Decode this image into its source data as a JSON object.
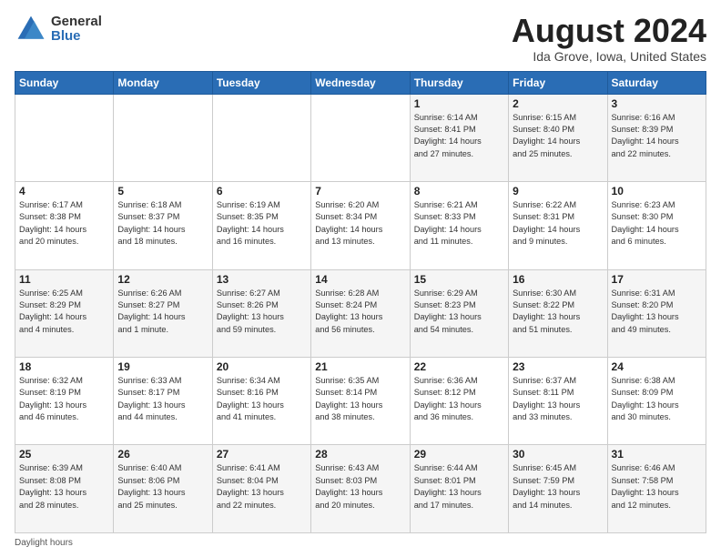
{
  "header": {
    "logo_general": "General",
    "logo_blue": "Blue",
    "title": "August 2024",
    "location": "Ida Grove, Iowa, United States"
  },
  "weekdays": [
    "Sunday",
    "Monday",
    "Tuesday",
    "Wednesday",
    "Thursday",
    "Friday",
    "Saturday"
  ],
  "weeks": [
    [
      {
        "day": "",
        "detail": ""
      },
      {
        "day": "",
        "detail": ""
      },
      {
        "day": "",
        "detail": ""
      },
      {
        "day": "",
        "detail": ""
      },
      {
        "day": "1",
        "detail": "Sunrise: 6:14 AM\nSunset: 8:41 PM\nDaylight: 14 hours\nand 27 minutes."
      },
      {
        "day": "2",
        "detail": "Sunrise: 6:15 AM\nSunset: 8:40 PM\nDaylight: 14 hours\nand 25 minutes."
      },
      {
        "day": "3",
        "detail": "Sunrise: 6:16 AM\nSunset: 8:39 PM\nDaylight: 14 hours\nand 22 minutes."
      }
    ],
    [
      {
        "day": "4",
        "detail": "Sunrise: 6:17 AM\nSunset: 8:38 PM\nDaylight: 14 hours\nand 20 minutes."
      },
      {
        "day": "5",
        "detail": "Sunrise: 6:18 AM\nSunset: 8:37 PM\nDaylight: 14 hours\nand 18 minutes."
      },
      {
        "day": "6",
        "detail": "Sunrise: 6:19 AM\nSunset: 8:35 PM\nDaylight: 14 hours\nand 16 minutes."
      },
      {
        "day": "7",
        "detail": "Sunrise: 6:20 AM\nSunset: 8:34 PM\nDaylight: 14 hours\nand 13 minutes."
      },
      {
        "day": "8",
        "detail": "Sunrise: 6:21 AM\nSunset: 8:33 PM\nDaylight: 14 hours\nand 11 minutes."
      },
      {
        "day": "9",
        "detail": "Sunrise: 6:22 AM\nSunset: 8:31 PM\nDaylight: 14 hours\nand 9 minutes."
      },
      {
        "day": "10",
        "detail": "Sunrise: 6:23 AM\nSunset: 8:30 PM\nDaylight: 14 hours\nand 6 minutes."
      }
    ],
    [
      {
        "day": "11",
        "detail": "Sunrise: 6:25 AM\nSunset: 8:29 PM\nDaylight: 14 hours\nand 4 minutes."
      },
      {
        "day": "12",
        "detail": "Sunrise: 6:26 AM\nSunset: 8:27 PM\nDaylight: 14 hours\nand 1 minute."
      },
      {
        "day": "13",
        "detail": "Sunrise: 6:27 AM\nSunset: 8:26 PM\nDaylight: 13 hours\nand 59 minutes."
      },
      {
        "day": "14",
        "detail": "Sunrise: 6:28 AM\nSunset: 8:24 PM\nDaylight: 13 hours\nand 56 minutes."
      },
      {
        "day": "15",
        "detail": "Sunrise: 6:29 AM\nSunset: 8:23 PM\nDaylight: 13 hours\nand 54 minutes."
      },
      {
        "day": "16",
        "detail": "Sunrise: 6:30 AM\nSunset: 8:22 PM\nDaylight: 13 hours\nand 51 minutes."
      },
      {
        "day": "17",
        "detail": "Sunrise: 6:31 AM\nSunset: 8:20 PM\nDaylight: 13 hours\nand 49 minutes."
      }
    ],
    [
      {
        "day": "18",
        "detail": "Sunrise: 6:32 AM\nSunset: 8:19 PM\nDaylight: 13 hours\nand 46 minutes."
      },
      {
        "day": "19",
        "detail": "Sunrise: 6:33 AM\nSunset: 8:17 PM\nDaylight: 13 hours\nand 44 minutes."
      },
      {
        "day": "20",
        "detail": "Sunrise: 6:34 AM\nSunset: 8:16 PM\nDaylight: 13 hours\nand 41 minutes."
      },
      {
        "day": "21",
        "detail": "Sunrise: 6:35 AM\nSunset: 8:14 PM\nDaylight: 13 hours\nand 38 minutes."
      },
      {
        "day": "22",
        "detail": "Sunrise: 6:36 AM\nSunset: 8:12 PM\nDaylight: 13 hours\nand 36 minutes."
      },
      {
        "day": "23",
        "detail": "Sunrise: 6:37 AM\nSunset: 8:11 PM\nDaylight: 13 hours\nand 33 minutes."
      },
      {
        "day": "24",
        "detail": "Sunrise: 6:38 AM\nSunset: 8:09 PM\nDaylight: 13 hours\nand 30 minutes."
      }
    ],
    [
      {
        "day": "25",
        "detail": "Sunrise: 6:39 AM\nSunset: 8:08 PM\nDaylight: 13 hours\nand 28 minutes."
      },
      {
        "day": "26",
        "detail": "Sunrise: 6:40 AM\nSunset: 8:06 PM\nDaylight: 13 hours\nand 25 minutes."
      },
      {
        "day": "27",
        "detail": "Sunrise: 6:41 AM\nSunset: 8:04 PM\nDaylight: 13 hours\nand 22 minutes."
      },
      {
        "day": "28",
        "detail": "Sunrise: 6:43 AM\nSunset: 8:03 PM\nDaylight: 13 hours\nand 20 minutes."
      },
      {
        "day": "29",
        "detail": "Sunrise: 6:44 AM\nSunset: 8:01 PM\nDaylight: 13 hours\nand 17 minutes."
      },
      {
        "day": "30",
        "detail": "Sunrise: 6:45 AM\nSunset: 7:59 PM\nDaylight: 13 hours\nand 14 minutes."
      },
      {
        "day": "31",
        "detail": "Sunrise: 6:46 AM\nSunset: 7:58 PM\nDaylight: 13 hours\nand 12 minutes."
      }
    ]
  ],
  "footer": "Daylight hours"
}
